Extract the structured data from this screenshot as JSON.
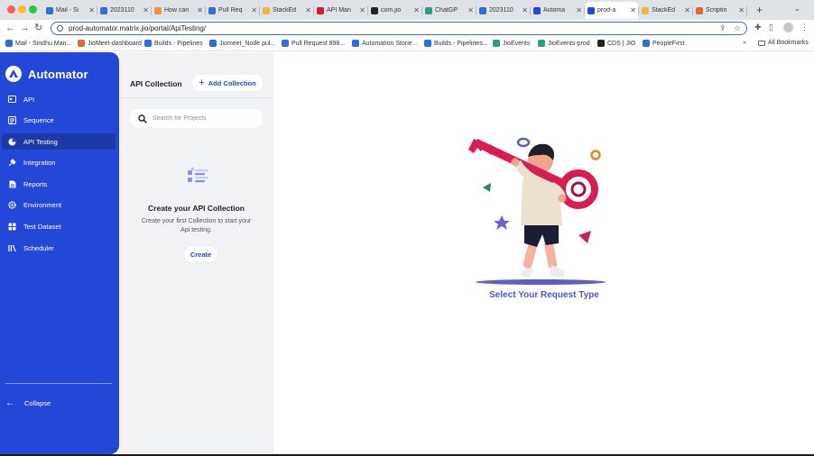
{
  "browser": {
    "tabs": [
      {
        "title": "Mail - Si",
        "color": "#2f6fd6"
      },
      {
        "title": "2023110",
        "color": "#2f6fd6"
      },
      {
        "title": "How can",
        "color": "#e59a3a"
      },
      {
        "title": "Pull Req",
        "color": "#2f6fd6"
      },
      {
        "title": "StackEd",
        "color": "#e8b93c"
      },
      {
        "title": "API Man",
        "color": "#c8202c"
      },
      {
        "title": "com.jio",
        "color": "#222222"
      },
      {
        "title": "ChatGP",
        "color": "#2e9d7e"
      },
      {
        "title": "2023110",
        "color": "#2f6fd6"
      },
      {
        "title": "Automa",
        "color": "#2347d6"
      },
      {
        "title": "prod-a",
        "color": "#2347d6"
      },
      {
        "title": "StackEd",
        "color": "#e8b93c"
      },
      {
        "title": "Scriptin",
        "color": "#e2663a"
      }
    ],
    "url": "prod-automator.matrix.jio/portal/ApiTesting/",
    "bookmarks": [
      {
        "label": "Mail - Sindhu Man...",
        "color": "#2f6fd6"
      },
      {
        "label": "JioMeet-dashboard",
        "color": "#e2663a"
      },
      {
        "label": "Builds - Pipelines",
        "color": "#2f6fd6"
      },
      {
        "label": "Jiomeet_Node pul...",
        "color": "#2f6fd6"
      },
      {
        "label": "Pull Request 898...",
        "color": "#2f6fd6"
      },
      {
        "label": "Automation Storie...",
        "color": "#2f6fd6"
      },
      {
        "label": "Builds - Pipelines...",
        "color": "#2f6fd6"
      },
      {
        "label": "JioEvents",
        "color": "#2e9d7e"
      },
      {
        "label": "JioEvents-prod",
        "color": "#2e9d7e"
      },
      {
        "label": "CDS | JIO",
        "color": "#222222"
      },
      {
        "label": "PeopleFirst",
        "color": "#2f6fd6"
      }
    ],
    "all_bookmarks": "All Bookmarks",
    "overflow": "»"
  },
  "sidebar": {
    "brand": "Automator",
    "items": [
      {
        "label": "API",
        "icon": "api-icon",
        "active": false
      },
      {
        "label": "Sequence",
        "icon": "sequence-icon",
        "active": false
      },
      {
        "label": "API Testing",
        "icon": "pie-chart-icon",
        "active": true
      },
      {
        "label": "Integration",
        "icon": "plug-icon",
        "active": false
      },
      {
        "label": "Reports",
        "icon": "document-icon",
        "active": false
      },
      {
        "label": "Environment",
        "icon": "gear-icon",
        "active": false
      },
      {
        "label": "Test Dataset",
        "icon": "dataset-icon",
        "active": false
      },
      {
        "label": "Scheduler",
        "icon": "scheduler-icon",
        "active": false
      }
    ],
    "collapse": "Collapse"
  },
  "panel": {
    "title": "API Collection",
    "add_label": "Add Collection",
    "search_placeholder": "Search for Projects",
    "empty_title": "Create your API Collection",
    "empty_desc": "Create your first Collection to start your Api testing.",
    "create_label": "Create"
  },
  "main": {
    "title": "Select Your Request Type"
  },
  "colors": {
    "accent": "#2347d6",
    "title": "#4f55c9",
    "key": "#d81e4f"
  }
}
